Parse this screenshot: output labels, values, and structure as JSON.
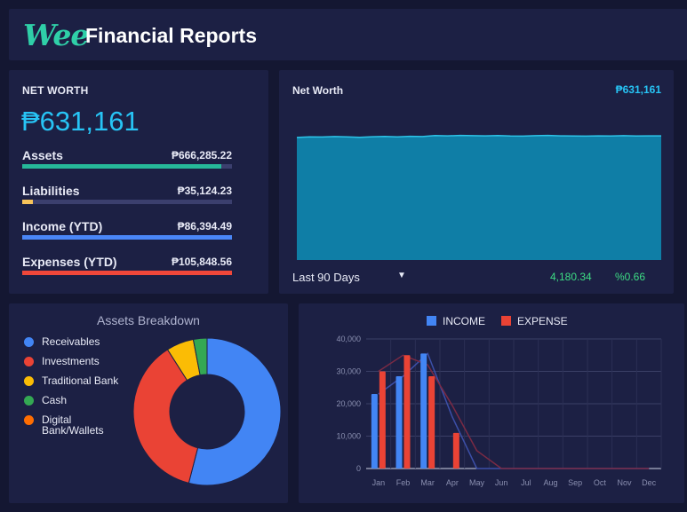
{
  "header": {
    "logo": "Wee",
    "title": "Financial Reports"
  },
  "net_worth_card": {
    "heading": "NET WORTH",
    "amount": "₱631,161",
    "rows": [
      {
        "label": "Assets",
        "value": "₱666,285.22",
        "fraction": 0.948,
        "color": "#26b99a"
      },
      {
        "label": "Liabilities",
        "value": "₱35,124.23",
        "fraction": 0.052,
        "color": "#f7c35a"
      },
      {
        "label": "Income (YTD)",
        "value": "₱86,394.49",
        "fraction": 1.0,
        "color": "#4a86f7"
      },
      {
        "label": "Expenses (YTD)",
        "value": "₱105,848.56",
        "fraction": 1.0,
        "color": "#f0473a"
      }
    ]
  },
  "net_worth_chart": {
    "title": "Net Worth",
    "value": "₱631,161",
    "range_label": "Last 90 Days",
    "change_amount": "4,180.34",
    "change_percent": "%0.66",
    "area_fill": "#0f7ea6",
    "line_color": "#2ec4e8",
    "series": [
      0.842,
      0.846,
      0.845,
      0.848,
      0.846,
      0.843,
      0.847,
      0.849,
      0.846,
      0.85,
      0.848,
      0.855,
      0.853,
      0.856,
      0.854,
      0.853,
      0.855,
      0.852,
      0.851,
      0.854,
      0.856,
      0.853,
      0.852,
      0.851,
      0.853,
      0.852,
      0.854,
      0.852,
      0.853,
      0.853
    ]
  },
  "assets_breakdown": {
    "title": "Assets Breakdown",
    "legend": [
      {
        "label": "Receivables",
        "color": "#4285f4"
      },
      {
        "label": "Investments",
        "color": "#ea4335"
      },
      {
        "label": "Traditional Bank",
        "color": "#fbbc05"
      },
      {
        "label": "Cash",
        "color": "#34a853"
      },
      {
        "label": "Digital Bank/Wallets",
        "color": "#ff6d01"
      }
    ]
  },
  "chart_data": [
    {
      "type": "pie",
      "title": "Assets Breakdown",
      "categories": [
        "Receivables",
        "Investments",
        "Traditional Bank",
        "Cash",
        "Digital Bank/Wallets"
      ],
      "values": [
        54,
        37,
        6,
        3,
        0
      ],
      "colors": [
        "#4285f4",
        "#ea4335",
        "#fbbc05",
        "#34a853",
        "#ff6d01"
      ],
      "donut": true
    },
    {
      "type": "bar",
      "title": "",
      "categories": [
        "Jan",
        "Feb",
        "Mar",
        "Apr",
        "May",
        "Jun",
        "Jul",
        "Aug",
        "Sep",
        "Oct",
        "Nov",
        "Dec"
      ],
      "series": [
        {
          "name": "INCOME",
          "color": "#4285f4",
          "values": [
            23000,
            28500,
            35500,
            0,
            0,
            0,
            0,
            0,
            0,
            0,
            0,
            0
          ]
        },
        {
          "name": "EXPENSE",
          "color": "#ea4335",
          "values": [
            30000,
            35000,
            28500,
            11000,
            0,
            0,
            0,
            0,
            0,
            0,
            0,
            0
          ]
        }
      ],
      "trend_lines": [
        {
          "name": "INCOME",
          "color": "#3c4fa8",
          "values": [
            23000,
            28500,
            35500,
            16000,
            0,
            0,
            0,
            0,
            0,
            0,
            0,
            0
          ]
        },
        {
          "name": "EXPENSE",
          "color": "#7a2a44",
          "values": [
            30000,
            35000,
            32000,
            19500,
            5500,
            0,
            0,
            0,
            0,
            0,
            0,
            0
          ]
        }
      ],
      "y_ticks": [
        "0",
        "10,000",
        "20,000",
        "30,000",
        "40,000"
      ],
      "ylim": [
        0,
        40000
      ],
      "legend": "top-center",
      "grid": true
    }
  ]
}
